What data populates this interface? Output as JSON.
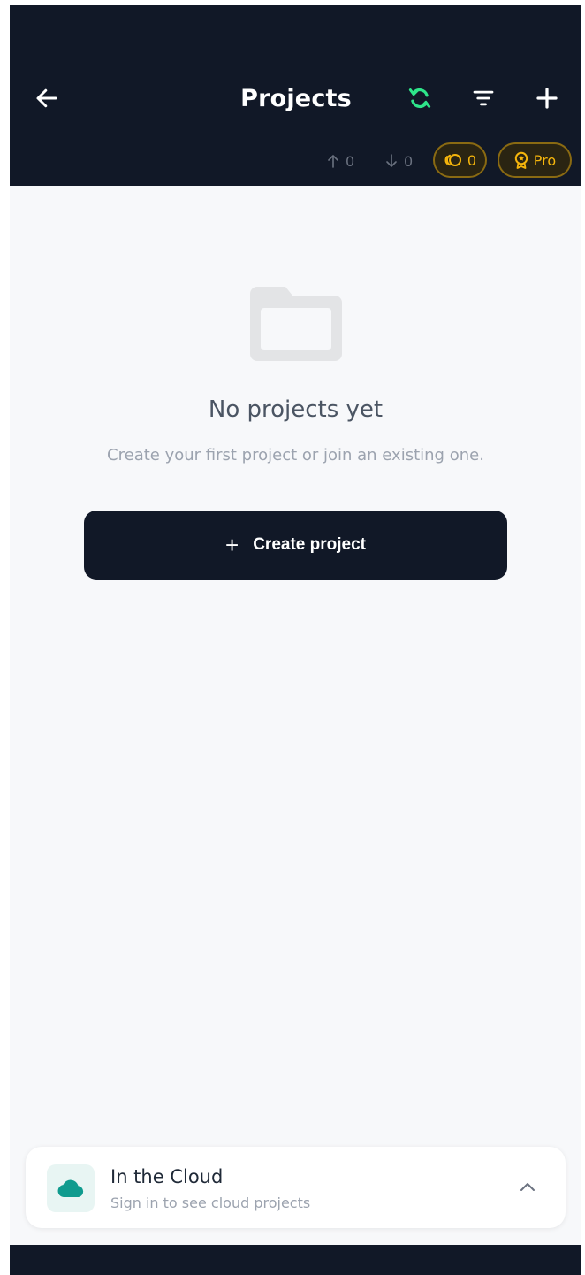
{
  "header": {
    "title": "Projects",
    "upload_count": "0",
    "download_count": "0",
    "coins": "0",
    "pro_label": "Pro",
    "icons": {
      "back": "arrow-left-icon",
      "sync": "sync-icon",
      "filter": "filter-icon",
      "add": "plus-icon"
    }
  },
  "empty_state": {
    "title": "No projects yet",
    "subtitle": "Create your first project or join an existing one.",
    "button_plus": "+",
    "button_label": "Create project"
  },
  "cloud": {
    "title": "In the Cloud",
    "subtitle": "Sign in to see cloud projects"
  },
  "colors": {
    "header_bg": "#111827",
    "sync_green": "#2ee58a",
    "gold": "#f5b50c",
    "page_bg": "#f7f8fa",
    "cloud_teal": "#0f9b8e"
  }
}
